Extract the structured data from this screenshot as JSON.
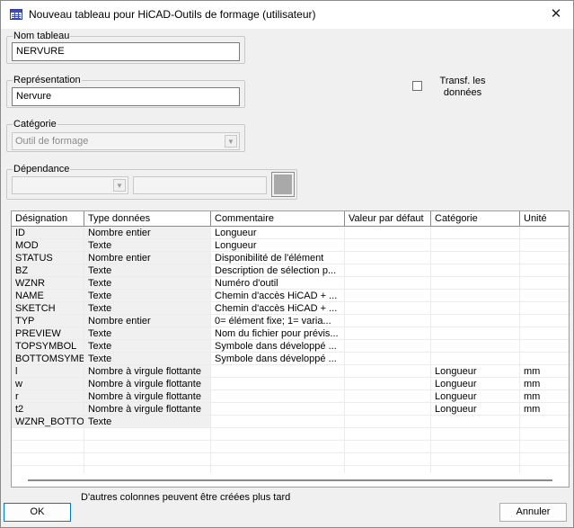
{
  "window": {
    "title": "Nouveau tableau pour HiCAD-Outils de formage (utilisateur)",
    "close_glyph": "✕"
  },
  "nom_tableau": {
    "label": "Nom tableau",
    "value": "NERVURE"
  },
  "representation": {
    "label": "Représentation",
    "value": "Nervure"
  },
  "categorie": {
    "label": "Catégorie",
    "value": "Outil de formage"
  },
  "dependance": {
    "label": "Dépendance",
    "value": "",
    "text": ""
  },
  "transf": {
    "label": "Transf. les données",
    "checked": false
  },
  "table": {
    "columns": [
      "Désignation",
      "Type données",
      "Commentaire",
      "Valeur par défaut",
      "Catégorie",
      "Unité"
    ],
    "rows": [
      [
        "ID",
        "Nombre entier",
        "Longueur",
        "",
        "",
        ""
      ],
      [
        "MOD",
        "Texte",
        "Longueur",
        "",
        "",
        ""
      ],
      [
        "STATUS",
        "Nombre entier",
        "Disponibilité de l'élément",
        "",
        "",
        ""
      ],
      [
        "BZ",
        "Texte",
        "Description de sélection p...",
        "",
        "",
        ""
      ],
      [
        "WZNR",
        "Texte",
        "Numéro d'outil",
        "",
        "",
        ""
      ],
      [
        "NAME",
        "Texte",
        "Chemin d'accès HiCAD + ...",
        "",
        "",
        ""
      ],
      [
        "SKETCH",
        "Texte",
        "Chemin d'accès HiCAD + ...",
        "",
        "",
        ""
      ],
      [
        "TYP",
        "Nombre entier",
        "0= élément fixe; 1= varia...",
        "",
        "",
        ""
      ],
      [
        "PREVIEW",
        "Texte",
        "Nom du fichier pour prévis...",
        "",
        "",
        ""
      ],
      [
        "TOPSYMBOL",
        "Texte",
        "Symbole dans développé ...",
        "",
        "",
        ""
      ],
      [
        "BOTTOMSYMBC",
        "Texte",
        "Symbole dans développé ...",
        "",
        "",
        ""
      ],
      [
        "l",
        "Nombre à virgule flottante",
        "",
        "",
        "Longueur",
        "mm"
      ],
      [
        "w",
        "Nombre à virgule flottante",
        "",
        "",
        "Longueur",
        "mm"
      ],
      [
        "r",
        "Nombre à virgule flottante",
        "",
        "",
        "Longueur",
        "mm"
      ],
      [
        "t2",
        "Nombre à virgule flottante",
        "",
        "",
        "Longueur",
        "mm"
      ],
      [
        "WZNR_BOTTON",
        "Texte",
        "",
        "",
        "",
        ""
      ],
      [
        "",
        "",
        "",
        "",
        "",
        ""
      ],
      [
        "",
        "",
        "",
        "",
        "",
        ""
      ],
      [
        "",
        "",
        "",
        "",
        "",
        ""
      ],
      [
        "",
        "",
        "",
        "",
        "",
        ""
      ]
    ]
  },
  "note": "D'autres colonnes peuvent être créées plus tard",
  "buttons": {
    "ok": "OK",
    "cancel": "Annuler"
  }
}
